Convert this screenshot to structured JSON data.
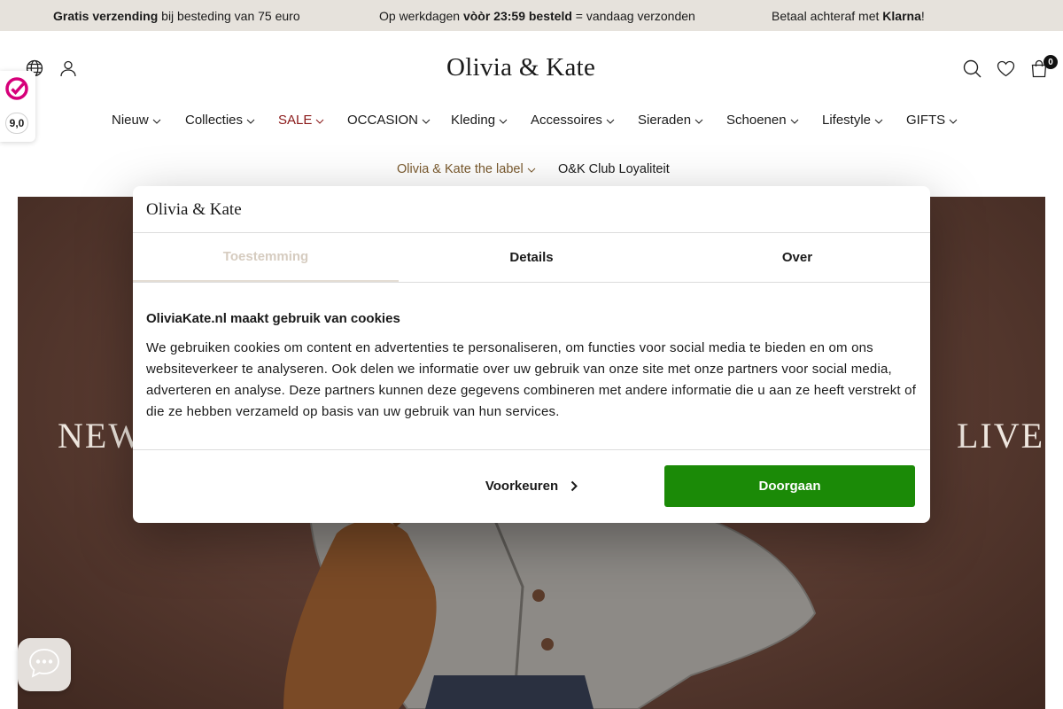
{
  "announcement": {
    "shipping_bold": "Gratis verzending",
    "shipping_rest": " bij besteding van 75 euro",
    "delivery_pre": "Op werkdagen ",
    "delivery_bold": "vòòr 23:59 besteld",
    "delivery_rest": " = vandaag verzonden",
    "pay_pre": "Betaal achteraf met ",
    "pay_bold": "Klarna",
    "pay_rest": "!"
  },
  "header": {
    "logo": "Olivia & Kate",
    "cart_count": "0",
    "icons": [
      "globe-icon",
      "user-icon",
      "search-icon",
      "heart-icon",
      "bag-icon"
    ]
  },
  "rating": {
    "score": "9,0"
  },
  "nav": {
    "row1": [
      "Nieuw",
      "Collecties",
      "SALE",
      "OCCASION",
      "Kleding",
      "Accessoires",
      "Sieraden",
      "Schoenen",
      "Lifestyle",
      "GIFTS"
    ],
    "row2": [
      "Olivia & Kate the label",
      "O&K Club Loyaliteit"
    ]
  },
  "hero": {
    "title_left": "NEW",
    "title_right": "LIVE"
  },
  "cookie_dialog": {
    "logo": "Olivia & Kate",
    "tabs": [
      "Toestemming",
      "Details",
      "Over"
    ],
    "heading": "OliviaKate.nl maakt gebruik van cookies",
    "body": "We gebruiken cookies om content en advertenties te personaliseren, om functies voor social media te bieden en om ons websiteverkeer te analyseren. Ook delen we informatie over uw gebruik van onze site met onze partners voor social media, adverteren en analyse. Deze partners kunnen deze gegevens combineren met andere informatie die u aan ze heeft verstrekt of die ze hebben verzameld op basis van uw gebruik van hun services.",
    "preferences_button": "Voorkeuren",
    "accept_button": "Doorgaan"
  },
  "colors": {
    "accept_green": "#1b8a07",
    "sale_red": "#8b1a1a",
    "label_brown": "#7a5a2e",
    "topbar_bg": "#e6e2dc",
    "hero_bg": "#5a3a30"
  }
}
